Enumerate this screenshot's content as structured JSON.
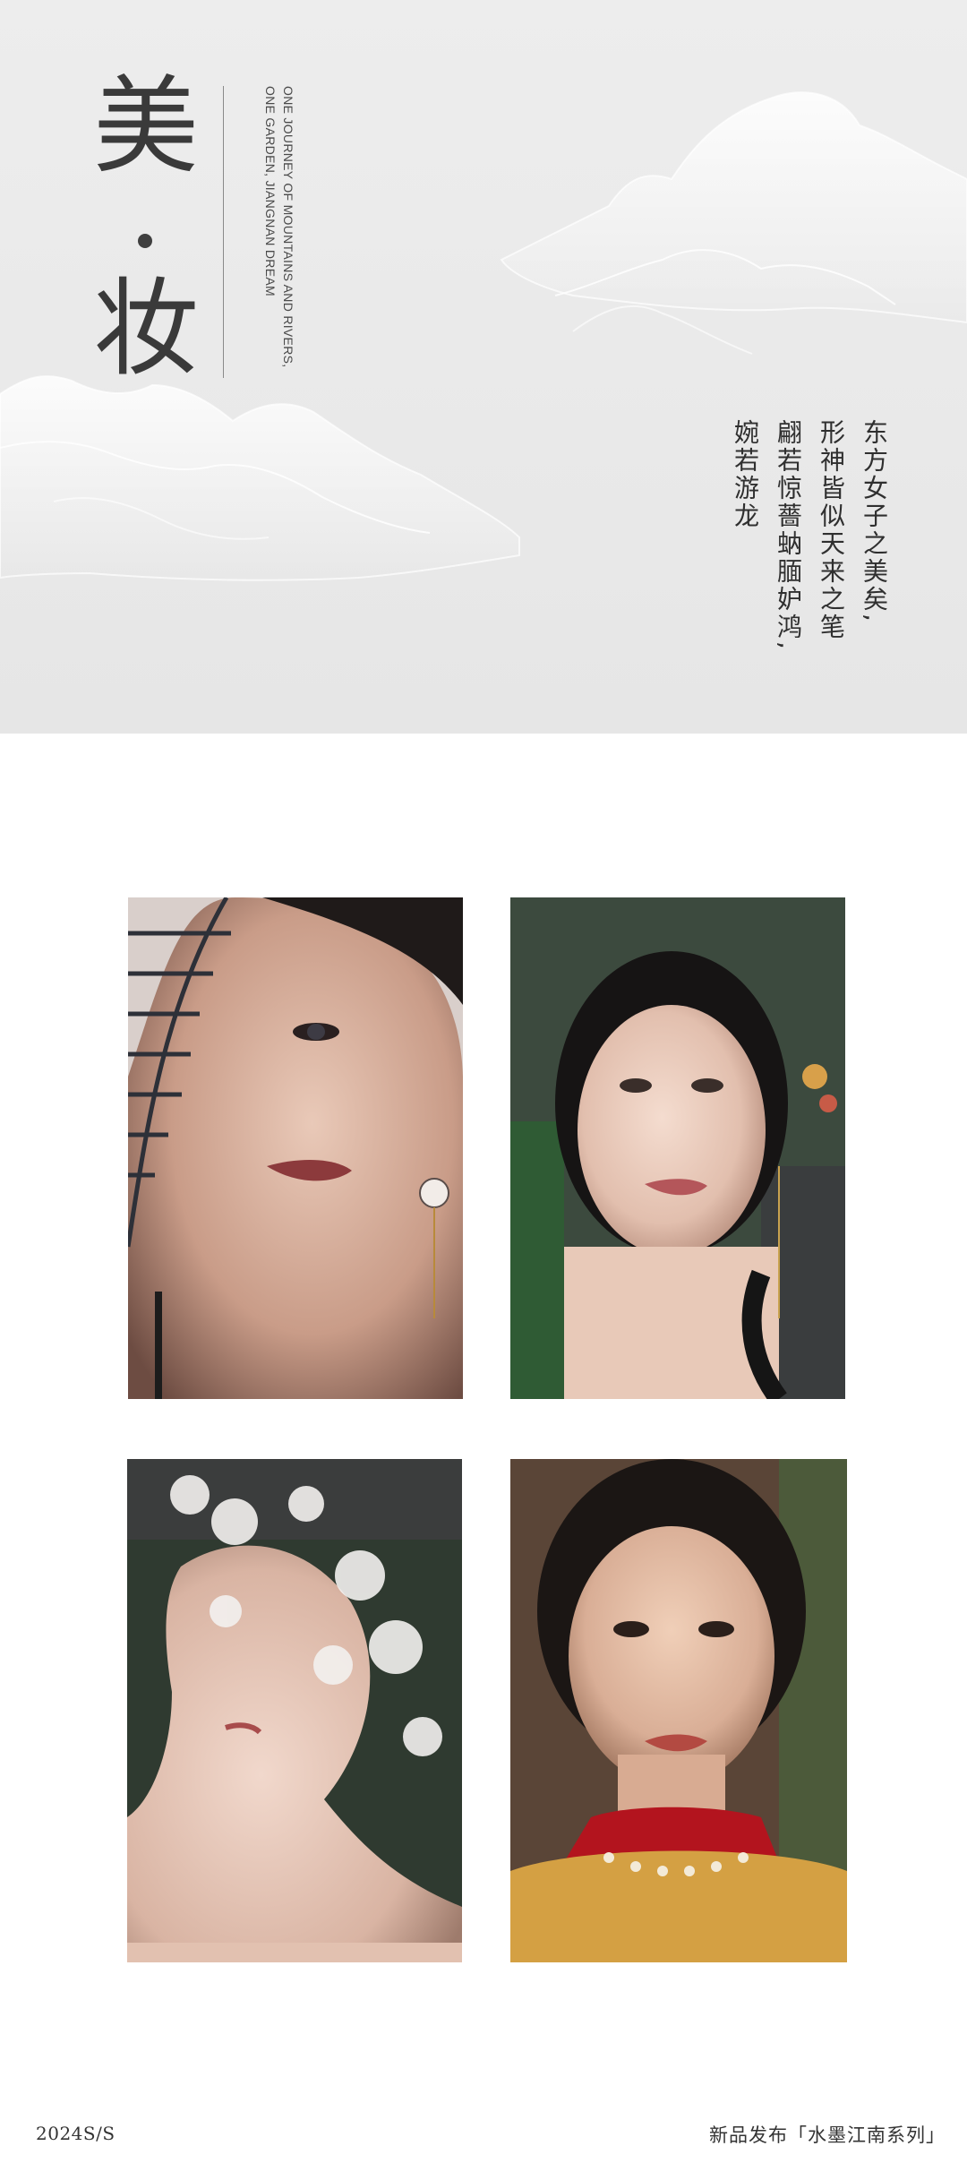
{
  "hero": {
    "title_char_1": "美",
    "title_char_2": "妆",
    "tagline_lines": [
      "ONE JOURNEY OF MOUNTAINS AND RIVERS,",
      "ONE GARDEN, JIANGNAN DREAM"
    ],
    "poem_lines": [
      "东方女子之美矣,",
      "形神皆似天来之笔",
      "翩若惊薔蚋腼妒鸿,",
      "婉若游龙"
    ],
    "background_color": "#ebebeb",
    "mountain_color": "#f7f7f7"
  },
  "gallery": {
    "photos": [
      {
        "subject": "woman-with-round-fan"
      },
      {
        "subject": "woman-with-hair-ornament"
      },
      {
        "subject": "woman-with-lace-veil"
      },
      {
        "subject": "woman-in-red-qipao"
      }
    ]
  },
  "footer": {
    "season_label": "2024S/S",
    "series_label": "新品发布「水墨江南系列」"
  }
}
